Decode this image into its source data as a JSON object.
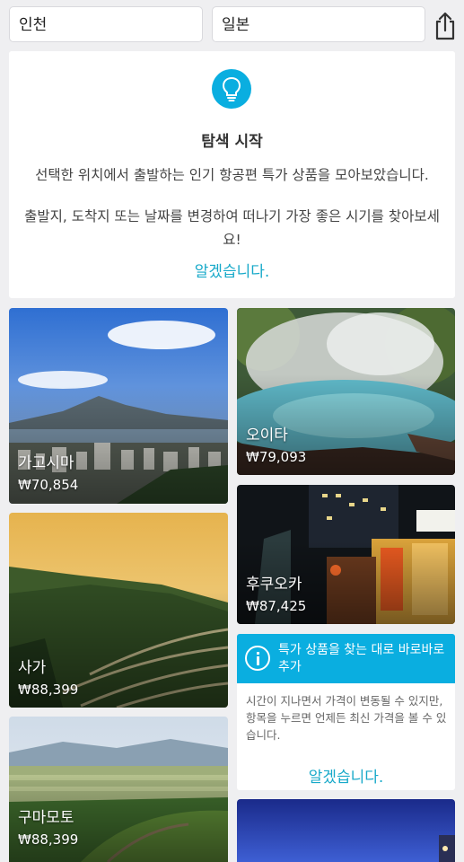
{
  "search": {
    "origin": "인천",
    "destination": "일본"
  },
  "explore_card": {
    "icon": "lightbulb-icon",
    "title": "탐색 시작",
    "description": "선택한 위치에서 출발하는 인기 항공편 특가 상품을 모아보았습니다.",
    "description2": "출발지, 도착지 또는 날짜를 변경하여 떠나기 가장 좋은 시기를 찾아보세요!",
    "ok_label": "알겠습니다."
  },
  "destinations": [
    {
      "city": "가고시마",
      "price": "₩70,854"
    },
    {
      "city": "오이타",
      "price": "₩79,093"
    },
    {
      "city": "후쿠오카",
      "price": "₩87,425"
    },
    {
      "city": "사가",
      "price": "₩88,399"
    },
    {
      "city": "구마모토",
      "price": "₩88,399"
    }
  ],
  "info_card": {
    "icon": "info-icon",
    "title": "특가 상품을 찾는 대로 바로바로 추가",
    "body": "시간이 지나면서 가격이 변동될 수 있지만, 항목을 누르면 언제든 최신 가격을 볼 수 있습니다.",
    "ok_label": "알겠습니다."
  },
  "colors": {
    "accent": "#0aaee0",
    "link": "#17a9c9",
    "background": "#efeff1"
  }
}
